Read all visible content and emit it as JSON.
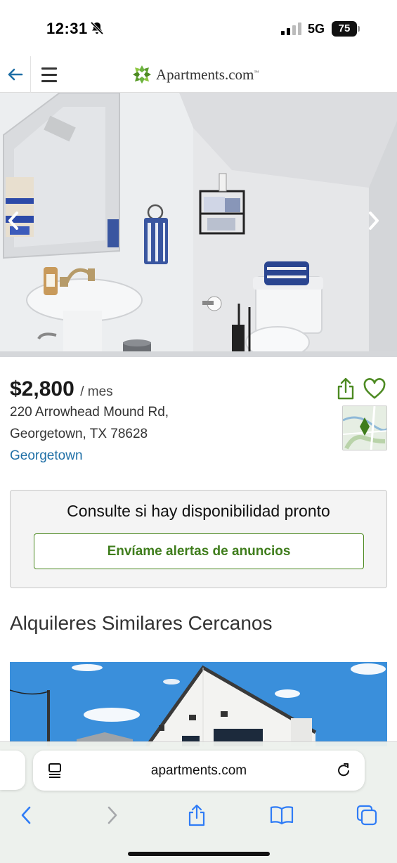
{
  "status_bar": {
    "time": "12:31",
    "network": "5G",
    "battery": "75"
  },
  "header": {
    "logo_text": "Apartments.com",
    "logo_tm": "™"
  },
  "listing": {
    "price": "$2,800",
    "price_unit": "/ mes",
    "address_line1": "220 Arrowhead Mound Rd,",
    "address_line2": "Georgetown, TX 78628",
    "neighborhood": "Georgetown"
  },
  "availability": {
    "title": "Consulte si hay disponibilidad pronto",
    "alert_button": "Envíame alertas de anuncios"
  },
  "similar": {
    "heading": "Alquileres Similares Cercanos"
  },
  "browser": {
    "url": "apartments.com"
  },
  "colors": {
    "brand_green": "#4d8a22",
    "link_blue": "#1f6fa6",
    "ios_blue": "#2f7cf6"
  },
  "icons": [
    "bell-off-icon",
    "signal-icon",
    "back-arrow-icon",
    "hamburger-icon",
    "chevron-left-icon",
    "chevron-right-icon",
    "share-icon",
    "heart-icon",
    "map-pin-icon",
    "page-menu-icon",
    "reload-icon",
    "back-icon",
    "forward-icon",
    "bookmarks-icon",
    "tabs-icon"
  ]
}
